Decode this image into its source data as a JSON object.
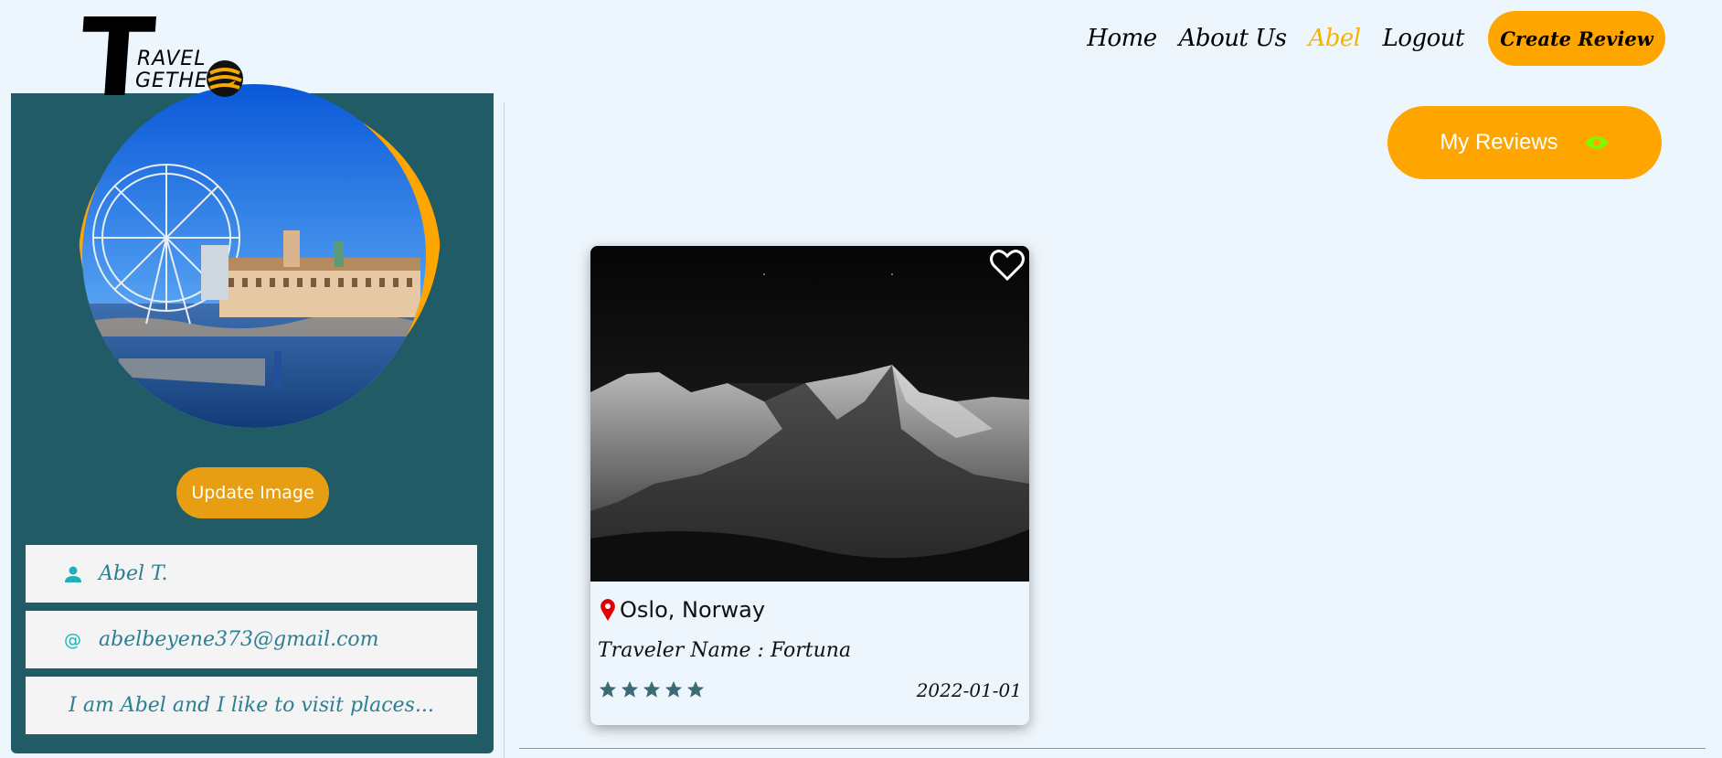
{
  "header": {
    "logo": {
      "letter": "T",
      "line1": "RAVEL",
      "line2": "GETHE"
    },
    "nav": [
      {
        "label": "Home",
        "active": false
      },
      {
        "label": "About Us",
        "active": false
      },
      {
        "label": "Abel",
        "active": true
      },
      {
        "label": "Logout",
        "active": false
      }
    ],
    "create_review_label": "Create Review"
  },
  "sidebar": {
    "update_image_label": "Update Image",
    "name": "Abel T.",
    "email": "abelbeyene373@gmail.com",
    "bio": "I am Abel and I like to visit places..."
  },
  "main": {
    "my_reviews_label": "My Reviews",
    "cards": [
      {
        "location": "Oslo, Norway",
        "traveler": "Traveler Name : Fortuna",
        "rating": 5,
        "date": "2022-01-01"
      }
    ]
  },
  "colors": {
    "accent": "#ffa500",
    "sidebar_bg": "#215c66",
    "background": "#eef6fd",
    "info_text": "#2a7f95",
    "eye_icon": "#7cfc00",
    "star": "#3d6b75",
    "pin": "#e00000"
  },
  "icons": {
    "globe": "globe-icon",
    "user": "user-icon",
    "at": "at-sign-icon",
    "eye": "eye-icon",
    "heart": "heart-icon",
    "pin": "location-pin-icon",
    "star": "star-icon"
  }
}
